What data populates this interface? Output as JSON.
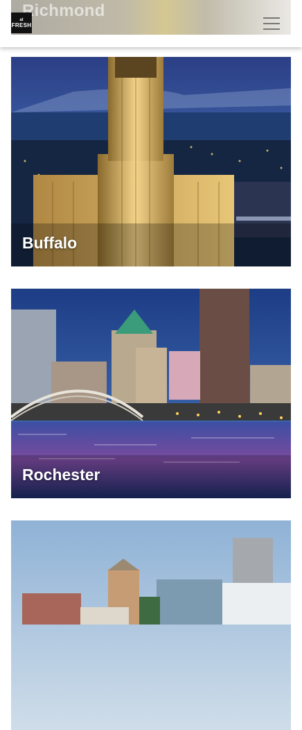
{
  "header": {
    "logo_text_top": "at",
    "logo_text_bottom": "FRESH",
    "background_peek_title": "Richmond",
    "menu_icon": "hamburger-menu-icon"
  },
  "cities": [
    {
      "name": "Buffalo"
    },
    {
      "name": "Rochester"
    },
    {
      "name": ""
    }
  ],
  "colors": {
    "header_bg": "#ffffff",
    "title_text": "#ffffff",
    "menu_icon": "#777777"
  }
}
